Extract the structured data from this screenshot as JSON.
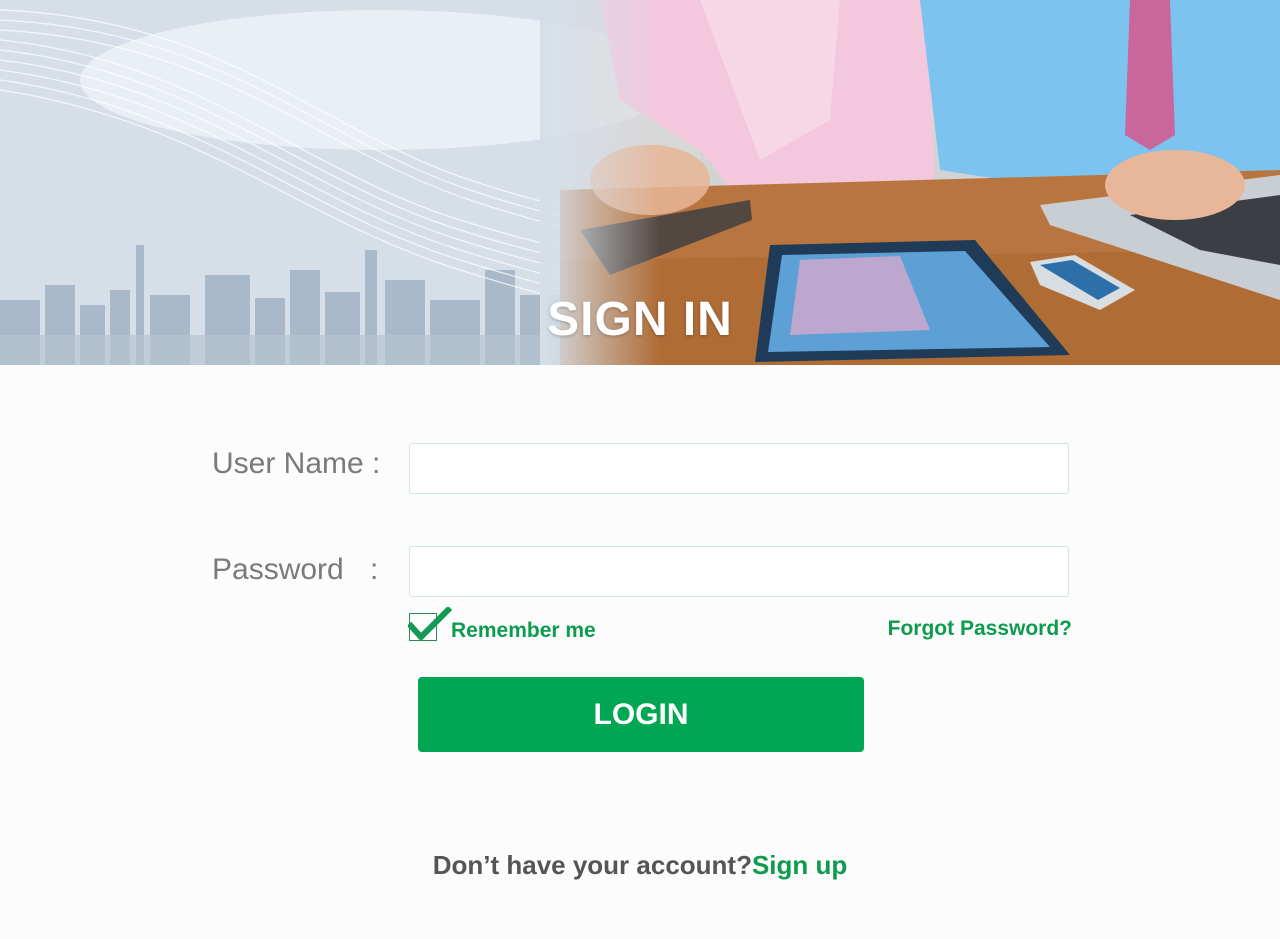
{
  "banner": {
    "title": "SIGN IN"
  },
  "form": {
    "username_label": "User Name :",
    "username_value": "",
    "password_label": "Password",
    "password_colon": ":",
    "password_value": "",
    "remember_label": "Remember me",
    "remember_checked": true,
    "forgot_label": "Forgot Password?",
    "login_label": "LOGIN"
  },
  "footer": {
    "prompt": "Don’t have your account?",
    "signup_label": "Sign up"
  },
  "colors": {
    "accent": "#00a651",
    "link": "#0d9c4f",
    "label": "#7a7a7a",
    "input_border": "#cde8d5"
  }
}
